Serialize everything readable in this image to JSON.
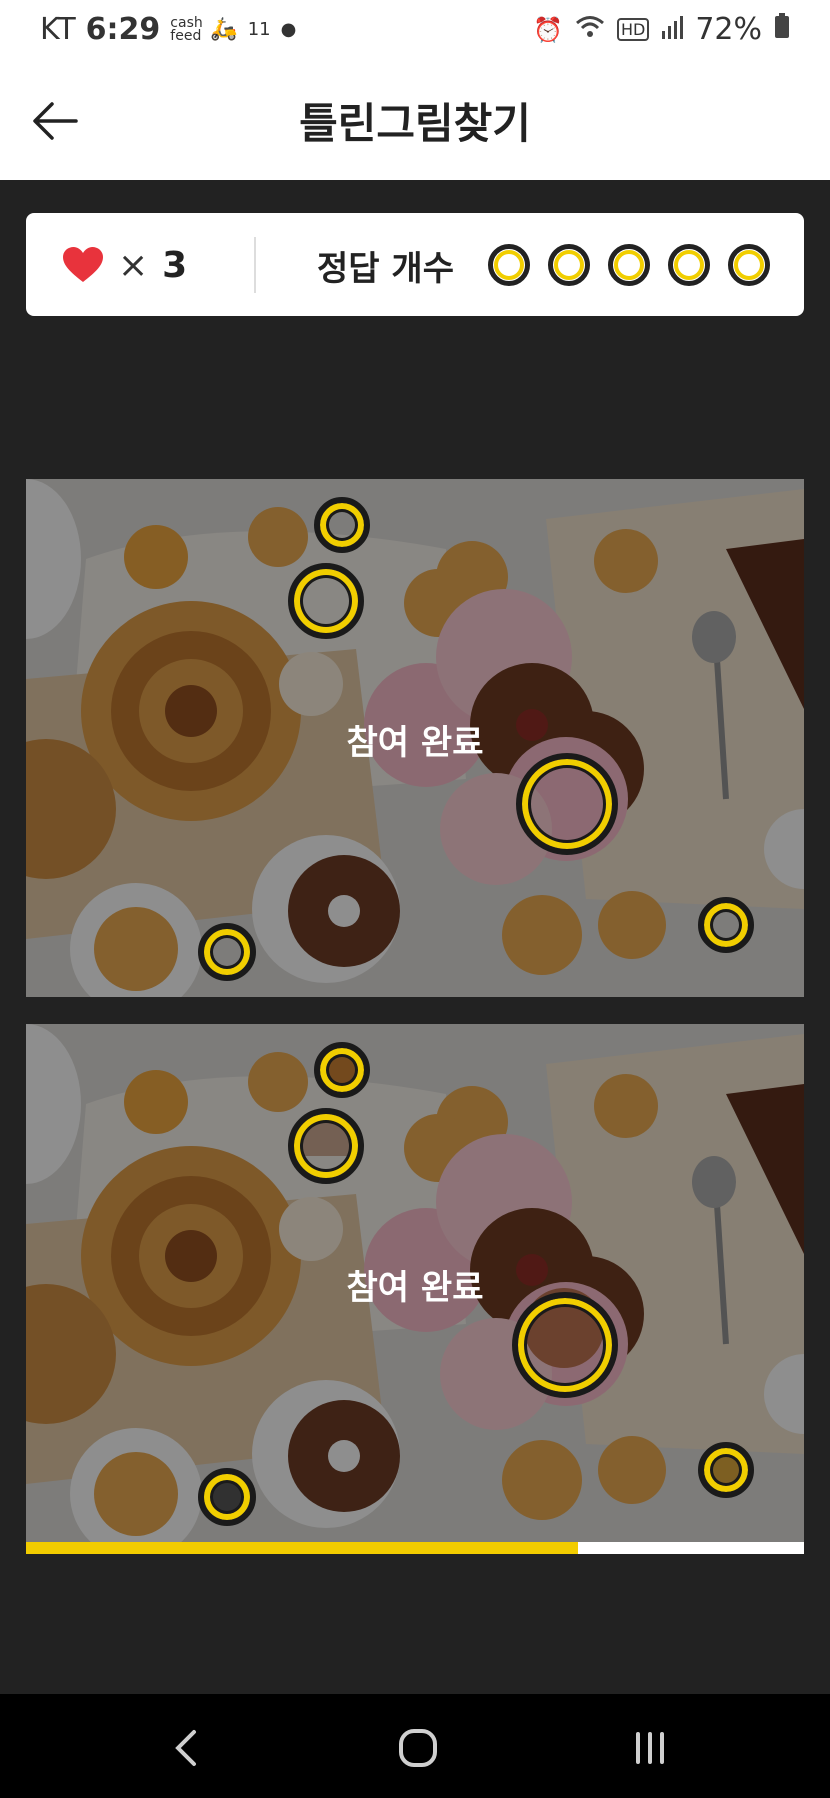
{
  "status_bar": {
    "carrier": "KT",
    "time": "6:29",
    "app_badge_1": "cash feed",
    "app_badge_2": "11",
    "battery_percent": "72%",
    "icons": [
      "alarm-icon",
      "wifi-icon",
      "hd-icon",
      "signal-icon",
      "battery-icon"
    ]
  },
  "header": {
    "title": "틀린그림찾기",
    "back_icon": "arrow-left-icon"
  },
  "info": {
    "lives_icon": "heart-icon",
    "lives_multiplier": "×",
    "lives_count": "3",
    "answers_label": "정답 개수",
    "answer_slots": 5
  },
  "puzzles": [
    {
      "overlay_text": "참여 완료"
    },
    {
      "overlay_text": "참여 완료"
    }
  ],
  "progress": {
    "fraction": 0.71
  },
  "colors": {
    "accent": "#F1CE00",
    "heart": "#E8333C",
    "background": "#222222"
  },
  "nav": {
    "icons": [
      "back-nav-icon",
      "home-nav-icon",
      "recents-nav-icon"
    ]
  }
}
